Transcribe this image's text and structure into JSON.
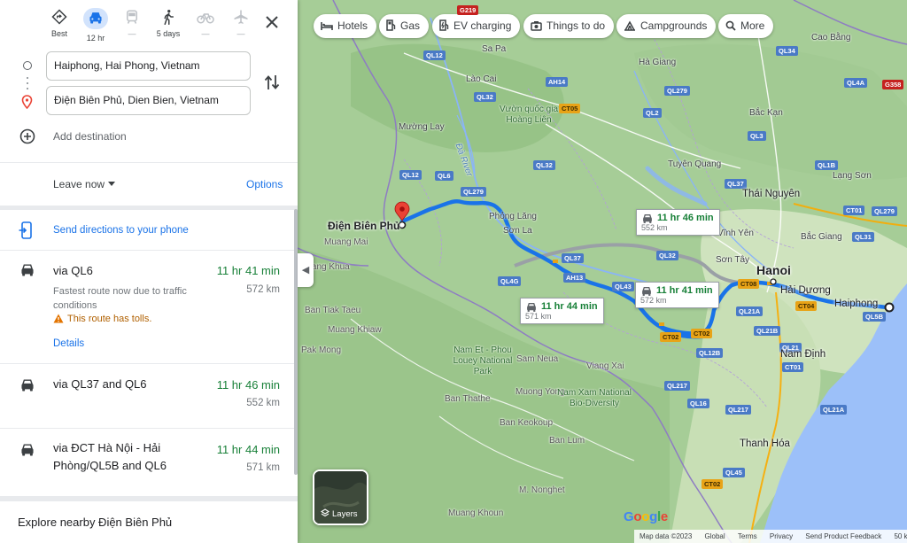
{
  "travel_modes": [
    {
      "label": "Best",
      "icon": "diamond-turn-icon"
    },
    {
      "label": "12 hr",
      "icon": "car-icon",
      "active": true
    },
    {
      "label": "—",
      "icon": "train-icon"
    },
    {
      "label": "5 days",
      "icon": "walk-icon"
    },
    {
      "label": "—",
      "icon": "bicycle-icon"
    },
    {
      "label": "—",
      "icon": "flight-icon"
    }
  ],
  "origin": "Haiphong, Hai Phong, Vietnam",
  "destination": "Điện Biên Phủ, Dien Bien, Vietnam",
  "add_destination": "Add destination",
  "leave_now": "Leave now",
  "options": "Options",
  "send_directions": "Send directions to your phone",
  "routes": [
    {
      "via": "via QL6",
      "time": "11 hr 41 min",
      "distance": "572 km",
      "note": "Fastest route now due to traffic conditions",
      "tolls": "This route has tolls.",
      "details": "Details"
    },
    {
      "via": "via QL37 and QL6",
      "time": "11 hr 46 min",
      "distance": "552 km"
    },
    {
      "via": "via ĐCT Hà Nội - Hải Phòng/QL5B and QL6",
      "time": "11 hr 44 min",
      "distance": "571 km"
    }
  ],
  "explore": "Explore nearby Điện Biên Phủ",
  "chips": [
    "Hotels",
    "Gas",
    "EV charging",
    "Things to do",
    "Campgrounds",
    "More"
  ],
  "map": {
    "bubbles": [
      {
        "time": "11 hr 46 min",
        "distance": "552 km"
      },
      {
        "time": "11 hr 41 min",
        "distance": "572 km"
      },
      {
        "time": "11 hr 44 min",
        "distance": "571 km"
      }
    ],
    "places": {
      "dien_bien_phu": "Điện Biên Phủ",
      "hanoi": "Hanoi",
      "hai_duong": "Hải Dương",
      "haiphong": "Haiphong",
      "thai_nguyen": "Thái Nguyên",
      "nam_dinh": "Nam Định",
      "thanh_hoa": "Thanh Hóa",
      "son_la": "Sơn La",
      "phong_lang": "Phỏng Lăng",
      "muong_lay": "Mường Lay",
      "muang_mai": "Muang Mai",
      "muang_khua": "Muang Khua",
      "ban_tiak_taeu": "Ban Tiak Taeu",
      "muang_khiaw": "Muang Khiaw",
      "pak_mong": "Pak Mong",
      "sam_neua": "Sam Neua",
      "viang_xai": "Viang Xai",
      "muong_yong": "Muong Yong",
      "ban_thathe": "Ban Thathe",
      "ban_keokoup": "Ban Keokoup",
      "ban_lum": "Ban Lum",
      "m_nonghet": "M. Nonghet",
      "muang_khoun": "Muang Khoun",
      "lao_cai": "Lào Cai",
      "ha_giang": "Hà Giang",
      "tuyen_quang": "Tuyên Quang",
      "cao_bang": "Cao Bằng",
      "bac_kan": "Bắc Kạn",
      "lang_son": "Lạng Sơn",
      "bac_giang": "Bắc Giang",
      "son_tay": "Sơn Tây",
      "vinh_yen": "Vĩnh Yên",
      "sa_pa": "Sa Pa",
      "hoang_lien": "Vườn quốc gia Hoàng Liên",
      "nam_et": "Nam Et - Phou Louey National Park",
      "nam_xam": "Nam Xam National Bio-Diversity",
      "da_river": "Đà River"
    },
    "layers": "Layers"
  },
  "footer": {
    "map_data": "Map data ©2023",
    "global": "Global",
    "terms": "Terms",
    "privacy": "Privacy",
    "feedback": "Send Product Feedback",
    "scale": "50 k"
  },
  "google": "Google",
  "colors": {
    "route": "#1a73e8",
    "alt_route": "#9aa0a6",
    "time_green": "#188038",
    "link_blue": "#1a73e8",
    "toll_orange": "#b06000"
  }
}
